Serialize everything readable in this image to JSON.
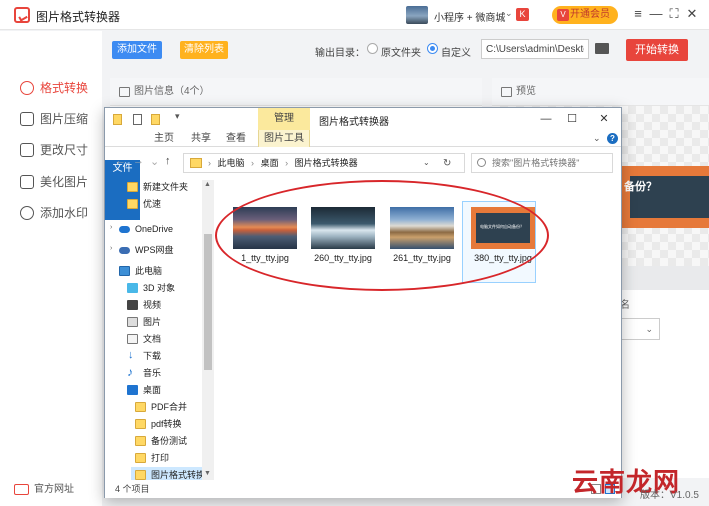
{
  "app": {
    "title": "图片格式转换器",
    "mini_program_label": "小程序 + 微商城",
    "brand_glyph": "K",
    "vip_label": "开通会员",
    "vip_glyph": "V",
    "controls": {
      "menu": "≡",
      "minimize": "—",
      "maximize": "⛶",
      "close": "✕"
    },
    "accent_color": "#e8453c"
  },
  "sidebar": {
    "items": [
      {
        "label": "格式转换",
        "icon": "refresh-circle-icon"
      },
      {
        "label": "图片压缩",
        "icon": "compress-icon"
      },
      {
        "label": "更改尺寸",
        "icon": "resize-icon"
      },
      {
        "label": "美化图片",
        "icon": "beautify-icon"
      },
      {
        "label": "添加水印",
        "icon": "watermark-icon"
      }
    ],
    "footer_label": "官方网址"
  },
  "toolbar": {
    "add_label": "添加文件",
    "clear_label": "清除列表",
    "output_label": "输出目录：",
    "radio_original": "原文件夹",
    "radio_custom": "自定义",
    "path_value": "C:\\Users\\admin\\Deskto",
    "start_label": "开始转换"
  },
  "panels": {
    "info_title": "图片信息（4个）",
    "preview_title": "预览",
    "preview_text": "备份？",
    "preview_option_label": "名",
    "preview_select_chev": "⌄"
  },
  "explorer": {
    "manage_tab": "管理",
    "title": "图片格式转换器",
    "qa_arrow": "▾",
    "controls": {
      "minimize": "—",
      "maximize": "☐",
      "close": "✕"
    },
    "ribbon_tabs": [
      "文件",
      "主页",
      "共享",
      "查看",
      "图片工具"
    ],
    "ribbon_chev": "⌄",
    "help_glyph": "?",
    "nav_glyphs": {
      "back": "←",
      "forward": "→",
      "history": "⌄",
      "up": "↑",
      "address_chev": "⌄",
      "refresh": "↻"
    },
    "address": {
      "segments": [
        "此电脑",
        "桌面",
        "图片格式转换器"
      ],
      "separator": "›"
    },
    "search_placeholder": "搜索\"图片格式转换器\"",
    "nav_tree": {
      "expand_glyph": "›",
      "scroll_up": "▲",
      "scroll_down": "▼",
      "items": [
        {
          "label": "新建文件夹",
          "icon": "folder"
        },
        {
          "label": "优速",
          "icon": "folder"
        },
        {
          "label": "OneDrive",
          "icon": "cloud"
        },
        {
          "label": "WPS网盘",
          "icon": "wps"
        },
        {
          "label": "此电脑",
          "icon": "pc"
        },
        {
          "label": "3D 对象",
          "icon": "cube"
        },
        {
          "label": "视频",
          "icon": "video"
        },
        {
          "label": "图片",
          "icon": "pic"
        },
        {
          "label": "文档",
          "icon": "doc"
        },
        {
          "label": "下载",
          "icon": "down"
        },
        {
          "label": "音乐",
          "icon": "music"
        },
        {
          "label": "桌面",
          "icon": "desk"
        },
        {
          "label": "PDF合并",
          "icon": "folder"
        },
        {
          "label": "pdf转换",
          "icon": "folder"
        },
        {
          "label": "备份测试",
          "icon": "folder"
        },
        {
          "label": "打印",
          "icon": "folder"
        },
        {
          "label": "图片格式转换器",
          "icon": "folder"
        }
      ]
    },
    "files": [
      {
        "name": "1_tty_tty.jpg"
      },
      {
        "name": "260_tty_tty.jpg"
      },
      {
        "name": "261_tty_tty.jpg"
      },
      {
        "name": "380_tty_tty.jpg",
        "thumb_text": "电脑文件如何自动备份？"
      }
    ],
    "status": "4 个项目"
  },
  "footer": {
    "watermark": "云南龙网",
    "version": "版本：V1.0.5"
  }
}
